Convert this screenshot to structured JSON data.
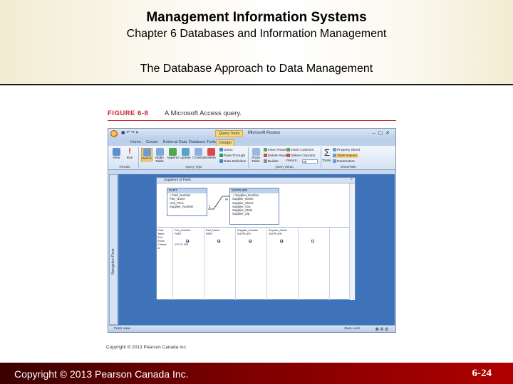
{
  "slide": {
    "title": "Management Information Systems",
    "chapter": "Chapter 6 Databases and Information Management",
    "subtitle": "The Database Approach to Data Management"
  },
  "figure": {
    "label": "FIGURE 6-8",
    "caption": "A Microsoft Access query.",
    "copyright": "Copyright © 2013 Pearson Canada Inc."
  },
  "access": {
    "window_title": "Microsoft Access",
    "contextual_tab": "Query Tools",
    "tabs": [
      "Home",
      "Create",
      "External Data",
      "Database Tools",
      "Design"
    ],
    "active_tab": "Design",
    "ribbon": {
      "buttons": [
        "View",
        "Run",
        "Select",
        "Make Table",
        "Append",
        "Update",
        "Crosstab",
        "Delete"
      ],
      "query_type_options": [
        "Union",
        "Pass-Through",
        "Data Definition"
      ],
      "show_table": "Show Table",
      "setup": [
        "Insert Rows",
        "Delete Rows",
        "Builder",
        "Insert Columns",
        "Delete Columns",
        "Return:"
      ],
      "return_value": "All",
      "totals": "Totals",
      "show_hide": [
        "Property Sheet",
        "Table Names",
        "Parameters"
      ],
      "groups": [
        "Results",
        "Query Type",
        "Query Setup",
        "Show/Hide"
      ]
    },
    "nav_pane_label": "Navigation Pane",
    "query_tab": "Suppliers of Parts",
    "tables": [
      {
        "name": "PART",
        "fields": [
          "Part_Number",
          "Part_Name",
          "Unit_Price",
          "Supplier_Number"
        ],
        "key_field": "Part_Number"
      },
      {
        "name": "SUPPLIER",
        "fields": [
          "Supplier_Number",
          "Supplier_Name",
          "Supplier_Street",
          "Supplier_City",
          "Supplier_State",
          "Supplier_Zip"
        ],
        "key_field": "Supplier_Number"
      }
    ],
    "grid": {
      "row_labels": [
        "Field:",
        "Table:",
        "Sort:",
        "Show:",
        "Criteria:",
        "or:"
      ],
      "columns": [
        {
          "field": "Part_Number",
          "table": "PART",
          "show": true,
          "criteria": "137 Or 150"
        },
        {
          "field": "Part_Name",
          "table": "PART",
          "show": true,
          "criteria": ""
        },
        {
          "field": "Supplier_Number",
          "table": "SUPPLIER",
          "show": true,
          "criteria": ""
        },
        {
          "field": "Supplier_Name",
          "table": "SUPPLIER",
          "show": true,
          "criteria": ""
        },
        {
          "field": "",
          "table": "",
          "show": false,
          "criteria": ""
        }
      ]
    },
    "status_left": "Form View",
    "status_right": "Num Lock"
  },
  "footer": {
    "copyright": "Copyright © 2013 Pearson Canada Inc.",
    "page": "6-24"
  },
  "colors": {
    "footer_red": "#b00000",
    "figure_red": "#c0272d",
    "workspace_blue": "#3e73b9",
    "ribbon_highlight": "#f7d27a"
  }
}
